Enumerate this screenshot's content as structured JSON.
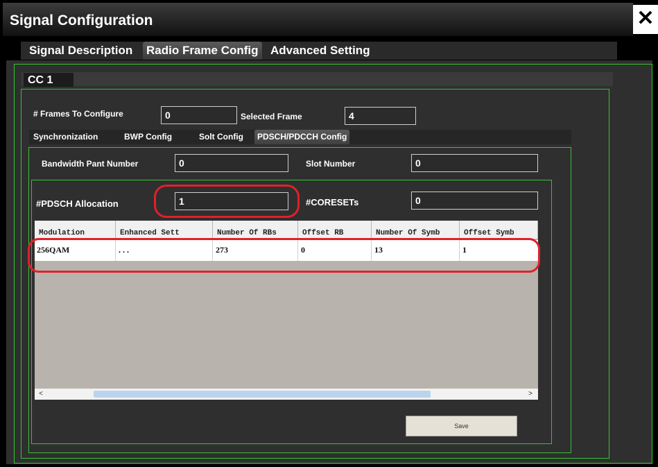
{
  "window": {
    "title": "Signal Configuration",
    "close_glyph": "✕"
  },
  "main_tabs": [
    {
      "label": "Signal Description"
    },
    {
      "label": "Radio Frame Config"
    },
    {
      "label": "Advanced Setting"
    }
  ],
  "cc_tab": {
    "label": "CC 1"
  },
  "frames": {
    "frames_label": "# Frames To Configure",
    "frames_value": "0",
    "selected_label": "Selected  Frame",
    "selected_value": "4"
  },
  "sub_tabs": [
    {
      "label": "Synchronization"
    },
    {
      "label": "BWP Config"
    },
    {
      "label": "Solt Config"
    },
    {
      "label": "PDSCH/PDCCH Config"
    }
  ],
  "bandwidth": {
    "bwp_label": "Bandwidth Pant Number",
    "bwp_value": "0",
    "slot_label": "Slot Number",
    "slot_value": "0"
  },
  "allocation": {
    "pdsch_label": "#PDSCH Allocation",
    "pdsch_value": "1",
    "coresets_label": "#CORESETs",
    "coresets_value": "0"
  },
  "table": {
    "headers": [
      "Modulation",
      "Enhanced Sett",
      "Number Of RBs",
      "Offset RB",
      "Number Of Symb",
      "Offset Symb"
    ],
    "rows": [
      [
        "256QAM",
        ". . .",
        "273",
        "0",
        "13",
        "1"
      ]
    ]
  },
  "scrollbar": {
    "left_glyph": "<",
    "right_glyph": ">"
  },
  "save_label": "Save",
  "colors": {
    "highlight": "#e2202a",
    "frame_green": "#35c335"
  }
}
